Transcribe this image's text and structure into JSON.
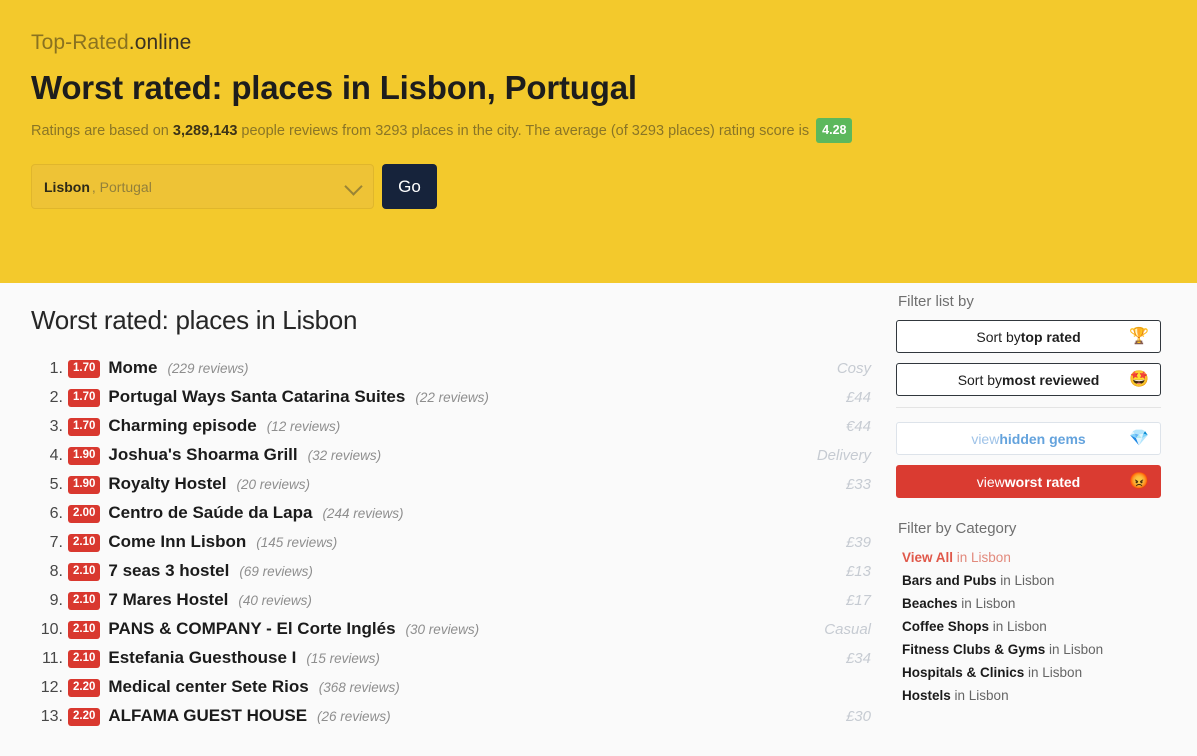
{
  "header": {
    "logo_main": "Top-Rated",
    "logo_tld": ".online",
    "title": "Worst rated: places in Lisbon, Portugal",
    "subtitle_pre": "Ratings are based on ",
    "subtitle_reviews": "3,289,143",
    "subtitle_mid": " people reviews from 3293 places in the city. The average (of 3293 places) rating score is ",
    "average_score": "4.28",
    "average_badge_color": "#5cb85c",
    "background_color": "#f3c92c",
    "search": {
      "city": "Lisbon",
      "country": ", Portugal",
      "dropdown_icon": "chevron-down-icon",
      "go_label": "Go"
    }
  },
  "main": {
    "section_title": "Worst rated: places in Lisbon",
    "badge_color": "#d9382f",
    "places": [
      {
        "rank": "1.",
        "score": "1.70",
        "name": "Mome",
        "reviews": "(229 reviews)",
        "tag": "Cosy"
      },
      {
        "rank": "2.",
        "score": "1.70",
        "name": "Portugal Ways Santa Catarina Suites",
        "reviews": "(22 reviews)",
        "tag": "£44"
      },
      {
        "rank": "3.",
        "score": "1.70",
        "name": "Charming episode",
        "reviews": "(12 reviews)",
        "tag": "€44"
      },
      {
        "rank": "4.",
        "score": "1.90",
        "name": "Joshua's Shoarma Grill",
        "reviews": "(32 reviews)",
        "tag": "Delivery"
      },
      {
        "rank": "5.",
        "score": "1.90",
        "name": "Royalty Hostel",
        "reviews": "(20 reviews)",
        "tag": "£33"
      },
      {
        "rank": "6.",
        "score": "2.00",
        "name": "Centro de Saúde da Lapa",
        "reviews": "(244 reviews)",
        "tag": ""
      },
      {
        "rank": "7.",
        "score": "2.10",
        "name": "Come Inn Lisbon",
        "reviews": "(145 reviews)",
        "tag": "£39"
      },
      {
        "rank": "8.",
        "score": "2.10",
        "name": "7 seas 3 hostel",
        "reviews": "(69 reviews)",
        "tag": "£13"
      },
      {
        "rank": "9.",
        "score": "2.10",
        "name": "7 Mares Hostel",
        "reviews": "(40 reviews)",
        "tag": "£17"
      },
      {
        "rank": "10.",
        "score": "2.10",
        "name": "PANS & COMPANY - El Corte Inglés",
        "reviews": "(30 reviews)",
        "tag": "Casual"
      },
      {
        "rank": "11.",
        "score": "2.10",
        "name": "Estefania Guesthouse I",
        "reviews": "(15 reviews)",
        "tag": "£34"
      },
      {
        "rank": "12.",
        "score": "2.20",
        "name": "Medical center Sete Rios",
        "reviews": "(368 reviews)",
        "tag": ""
      },
      {
        "rank": "13.",
        "score": "2.20",
        "name": "ALFAMA GUEST HOUSE",
        "reviews": "(26 reviews)",
        "tag": "£30"
      }
    ]
  },
  "sidebar": {
    "filter_heading": "Filter list by",
    "buttons": [
      {
        "prefix": "Sort by ",
        "strong": "top rated",
        "emoji": "🏆",
        "icon_name": "trophy-icon"
      },
      {
        "prefix": "Sort by ",
        "strong": "most reviewed",
        "emoji": "🤩",
        "icon_name": "star-struck-icon"
      },
      {
        "prefix": "view ",
        "strong": "hidden gems",
        "emoji": "💎",
        "icon_name": "gem-icon"
      },
      {
        "prefix": "view ",
        "strong": "worst rated",
        "emoji": "😡",
        "icon_name": "angry-face-icon"
      }
    ],
    "category_heading": "Filter by Category",
    "categories": [
      {
        "strong": "View All",
        "suffix": " in Lisbon",
        "active": true
      },
      {
        "strong": "Bars and Pubs",
        "suffix": " in Lisbon",
        "active": false
      },
      {
        "strong": "Beaches",
        "suffix": " in Lisbon",
        "active": false
      },
      {
        "strong": "Coffee Shops",
        "suffix": " in Lisbon",
        "active": false
      },
      {
        "strong": "Fitness Clubs & Gyms",
        "suffix": " in Lisbon",
        "active": false
      },
      {
        "strong": "Hospitals & Clinics",
        "suffix": " in Lisbon",
        "active": false
      },
      {
        "strong": "Hostels",
        "suffix": " in Lisbon",
        "active": false
      }
    ]
  }
}
